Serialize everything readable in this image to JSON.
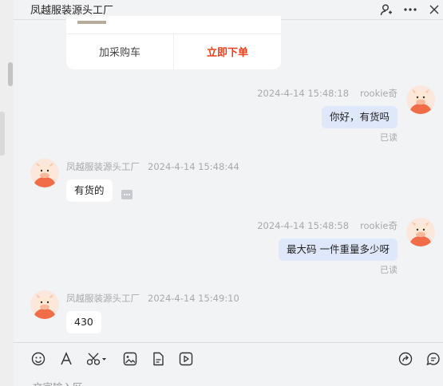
{
  "header": {
    "title": "凤越服装源头工厂",
    "icons": [
      "user-icon",
      "more-icon"
    ]
  },
  "card": {
    "add_cart_label": "加采购车",
    "order_label": "立即下单"
  },
  "messages": [
    {
      "direction": "out",
      "sender": "rookie奇",
      "time": "2024-4-14 15:48:18",
      "text": "你好，有货吗",
      "status": "已读"
    },
    {
      "direction": "in",
      "sender": "凤越服装源头工厂",
      "time": "2024-4-14 15:48:44",
      "text": "有货的"
    },
    {
      "direction": "out",
      "sender": "rookie奇",
      "time": "2024-4-14 15:48:58",
      "text": "最大码 一件重量多少呀",
      "status": "已读"
    },
    {
      "direction": "in",
      "sender": "凤越服装源头工厂",
      "time": "2024-4-14 15:49:10",
      "text": "430"
    }
  ],
  "toolbar": {
    "left_icons": [
      "emoji-icon",
      "font-icon",
      "scissors-icon",
      "image-icon",
      "file-icon",
      "video-icon"
    ],
    "right_icons": [
      "share-icon",
      "quick-reply-icon"
    ]
  },
  "input": {
    "placeholder": "文字输入区"
  },
  "colors": {
    "accent": "#ea3e1a",
    "outgoing_bubble": "#dfe8fb",
    "avatar_bg": "#fbe7dc"
  }
}
